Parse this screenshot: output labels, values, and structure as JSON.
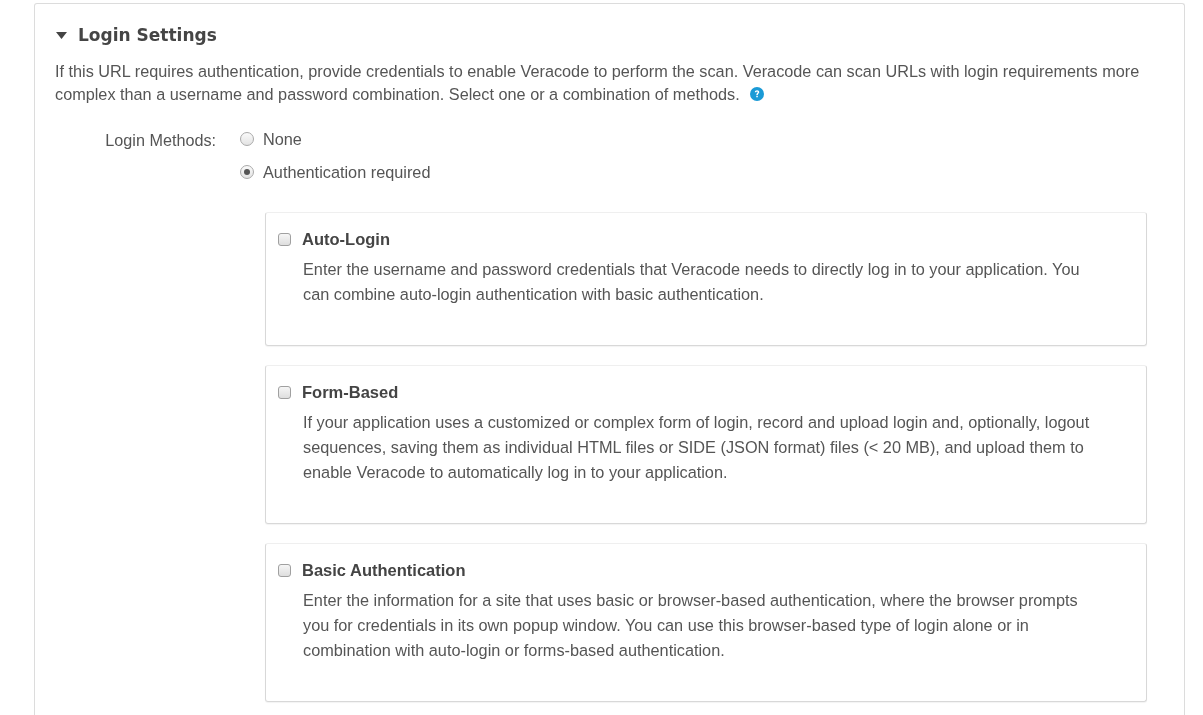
{
  "section": {
    "title": "Login Settings",
    "expanded": true,
    "description": "If this URL requires authentication, provide credentials to enable Veracode to perform the scan. Veracode can scan URLs with login requirements more complex than a username and password combination. Select one or a combination of methods.",
    "login_methods": {
      "label": "Login Methods:",
      "options": [
        {
          "label": "None",
          "selected": false
        },
        {
          "label": "Authentication required",
          "selected": true
        }
      ]
    },
    "methods": [
      {
        "title": "Auto-Login",
        "checked": false,
        "description": "Enter the username and password credentials that Veracode needs to directly log in to your application. You can combine auto-login authentication with basic authentication."
      },
      {
        "title": "Form-Based",
        "checked": false,
        "description": "If your application uses a customized or complex form of login, record and upload login and, optionally, logout sequences, saving them as individual HTML files or SIDE (JSON format) files (< 20 MB), and upload them to enable Veracode to automatically log in to your application."
      },
      {
        "title": "Basic Authentication",
        "checked": false,
        "description": "Enter the information for a site that uses basic or browser-based authentication, where the browser prompts you for credentials in its own popup window. You can use this browser-based type of login alone or in combination with auto-login or forms-based authentication."
      }
    ]
  }
}
